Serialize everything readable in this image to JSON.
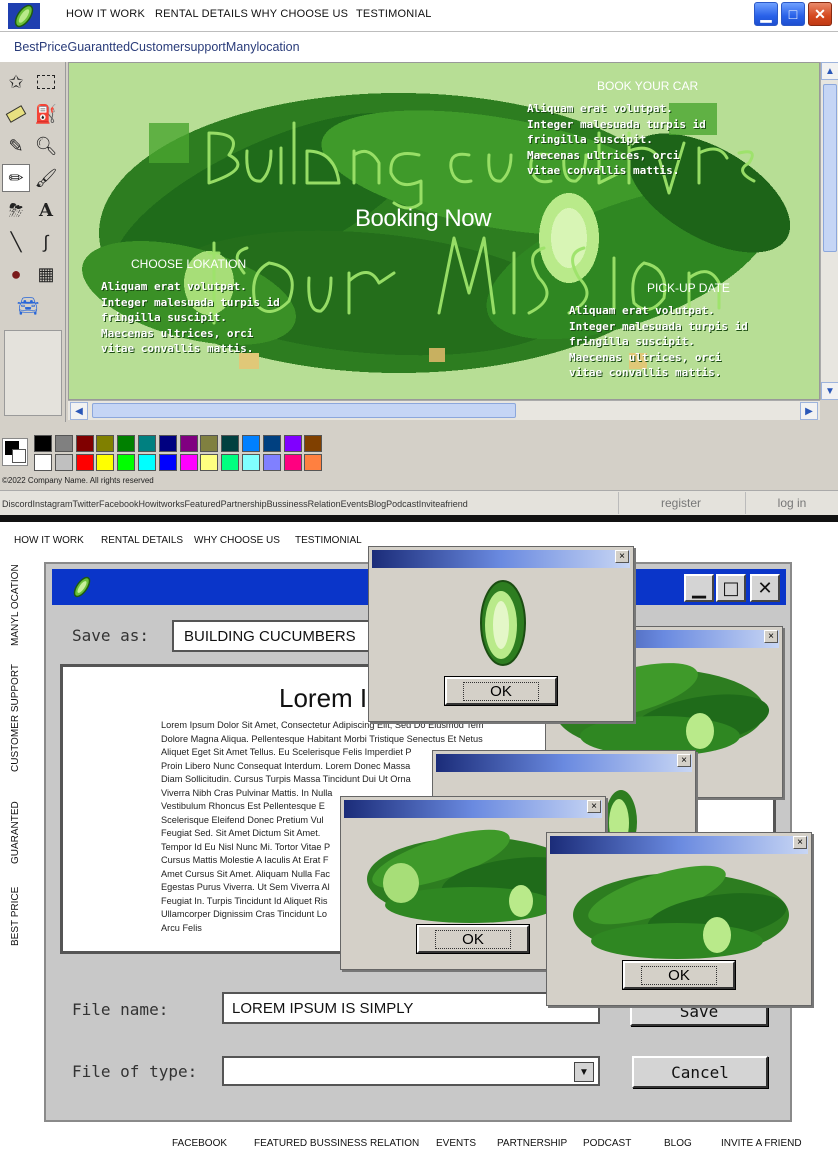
{
  "top_window": {
    "nav": [
      "HOW IT WORK",
      "RENTAL DETAILS",
      "WHY CHOOSE US",
      "TESTIMONIAL"
    ],
    "window_buttons": [
      "minimize",
      "maximize",
      "close"
    ],
    "menubar": "BestPriceGuaranttedCustomersupportManylocation",
    "tools": [
      "star-select-icon",
      "rect-select-icon",
      "eraser-icon",
      "fill-bucket-icon",
      "eyedropper-icon",
      "magnifier-icon",
      "pencil-icon",
      "brush-icon",
      "airbrush-icon",
      "text-icon",
      "line-icon",
      "curve-icon",
      "location-pin-icon",
      "calendar-icon",
      "car-icon"
    ],
    "canvas": {
      "title_handwritten": "Building cucumbers is our mission",
      "book_label": "BOOK YOUR CAR",
      "book_text": "Aliquam erat volutpat.\nInteger malesuada turpis id\nfringilla suscipit.\nMaecenas ultrices, orci\nvitae convallis mattis.",
      "booking_now": "Booking Now",
      "location_label": "CHOOSE LOKATION",
      "location_text": "Aliquam erat volutpat.\nInteger malesuada turpis id\nfringilla suscipit.\nMaecenas ultrices, orci\nvitae convallis mattis.",
      "pickup_label": "PICK-UP DATE",
      "pickup_text": "Aliquam erat volutpat.\nInteger malesuada turpis id\nfringilla suscipit.\nMaecenas ultrices, orci\nvitae convallis mattis."
    },
    "palette_colors": [
      "#000000",
      "#808080",
      "#800000",
      "#808000",
      "#008000",
      "#008080",
      "#000080",
      "#800080",
      "#808040",
      "#004040",
      "#0080ff",
      "#004080",
      "#8000ff",
      "#804000",
      "#ffffff",
      "#c0c0c0",
      "#ff0000",
      "#ffff00",
      "#00ff00",
      "#00ffff",
      "#0000ff",
      "#ff00ff",
      "#ffff80",
      "#00ff80",
      "#80ffff",
      "#8080ff",
      "#ff0080",
      "#ff8040"
    ],
    "copyright": "©2022 Company Name. All rights reserved",
    "status_links": "DiscordInstagramTwitterFacebookHowitworksFeaturedPartnershipBussinessRelationEventsBlogPodcastInviteafriend",
    "register": "register",
    "login": "log in"
  },
  "bottom": {
    "nav": [
      "HOW IT WORK",
      "RENTAL DETAILS",
      "WHY CHOOSE US",
      "TESTIMONIAL"
    ],
    "side_nav": [
      "MANYL OCATION",
      "CUSTOMER SUPPORT",
      "GUARANTED",
      "BEST PRICE"
    ],
    "save_dialog": {
      "save_as_label": "Save as:",
      "save_as_value": "BUILDING CUCUMBERS",
      "doc_title": "Lorem Ip",
      "doc_lines": [
        "Lorem Ipsum Dolor Sit Amet, Consectetur Adipiscing Elit, Sed Do Eiusmod Tem",
        "Dolore Magna Aliqua. Pellentesque Habitant Morbi Tristique Senectus Et Netus",
        "Aliquet Eget Sit Amet Tellus. Eu Scelerisque Felis Imperdiet P",
        "Proin Libero Nunc Consequat Interdum. Lorem Donec Massa",
        "Diam Sollicitudin. Cursus Turpis Massa Tincidunt Dui Ut Orna",
        "Viverra Nibh Cras Pulvinar Mattis. In Nulla",
        "Vestibulum Rhoncus Est Pellentesque E",
        "Scelerisque Eleifend Donec Pretium Vul",
        "Feugiat Sed. Sit Amet Dictum Sit Amet.",
        "Tempor Id Eu Nisl Nunc Mi. Tortor Vitae P",
        "Cursus Mattis Molestie A Iaculis At Erat F",
        "Amet Cursus Sit Amet. Aliquam Nulla Fac",
        "Egestas Purus Viverra. Ut Sem Viverra Al",
        "Feugiat In. Turpis Tincidunt Id Aliquet Ris",
        "Ullamcorper Dignissim Cras Tincidunt Lo",
        "Arcu Felis"
      ],
      "file_name_label": "File name:",
      "file_name_value": "LOREM IPSUM IS SIMPLY",
      "file_type_label": "File of type:",
      "save_button": "Save",
      "cancel_button": "Cancel"
    },
    "popups": {
      "ok_label": "OK",
      "close_glyph": "×"
    },
    "footer": [
      "FACEBOOK",
      "FEATURED BUSSINESS RELATION",
      "EVENTS",
      "PARTNERSHIP",
      "PODCAST",
      "BLOG",
      "INVITE A FRIEND"
    ]
  },
  "colors": {
    "canvas_green": "#b7de95",
    "cucumber_dark": "#1f6b1a",
    "cucumber_mid": "#3f9a2a",
    "title_blue": "#0a35c9"
  }
}
